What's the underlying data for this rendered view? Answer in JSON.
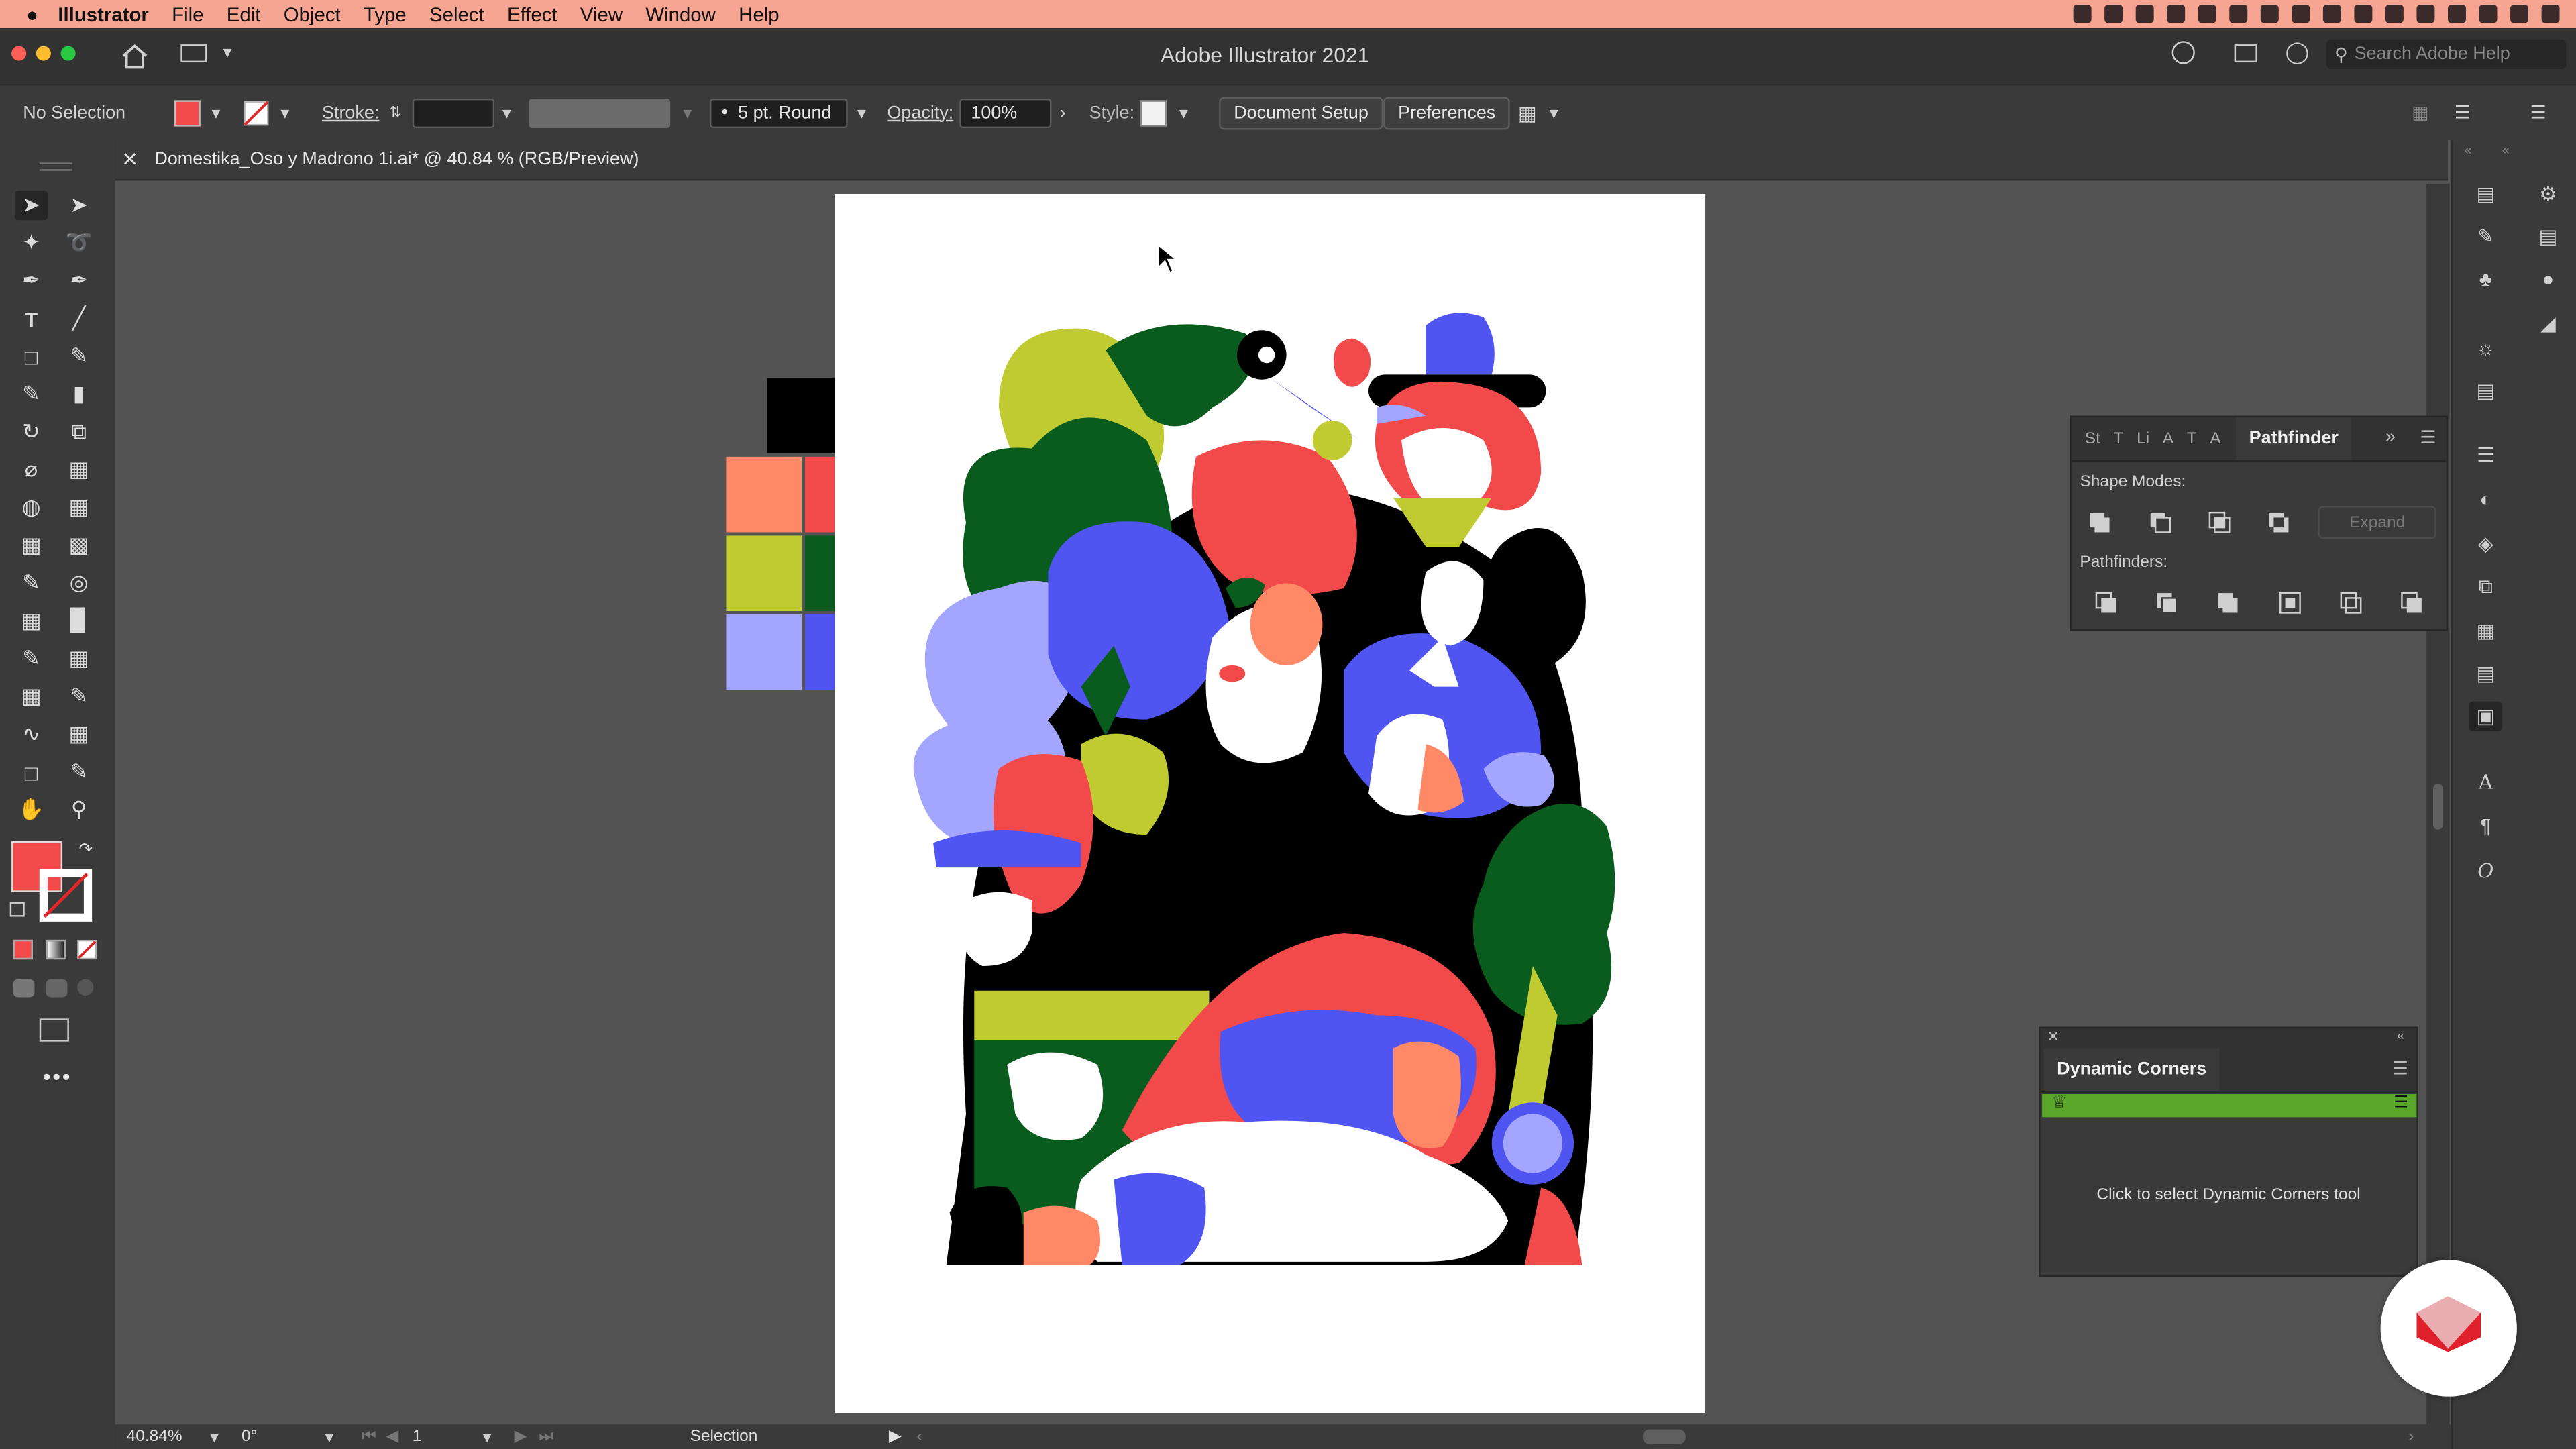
{
  "menubar": {
    "app_name": "Illustrator",
    "items": [
      "File",
      "Edit",
      "Object",
      "Type",
      "Select",
      "Effect",
      "View",
      "Window",
      "Help"
    ]
  },
  "appbar": {
    "title": "Adobe Illustrator 2021",
    "search_placeholder": "Search Adobe Help"
  },
  "control_bar": {
    "selection_label": "No Selection",
    "fill_color": "#f2494a",
    "stroke_label": "Stroke:",
    "brush_label": "5 pt. Round",
    "opacity_label": "Opacity:",
    "opacity_value": "100%",
    "style_label": "Style:",
    "document_setup_label": "Document Setup",
    "preferences_label": "Preferences"
  },
  "document_tab": {
    "title": "Domestika_Oso y Madrono 1i.ai* @ 40.84 % (RGB/Preview)"
  },
  "pathfinder_panel": {
    "tabs": [
      "St",
      "T",
      "Li",
      "A",
      "T",
      "A"
    ],
    "active_tab": "Pathfinder",
    "shape_modes_label": "Shape Modes:",
    "expand_label": "Expand",
    "pathfinders_label": "Pathfinders:"
  },
  "dynamic_corners_panel": {
    "title": "Dynamic Corners",
    "message": "Click to select Dynamic Corners tool",
    "bar_color": "#5aa62a"
  },
  "status_bar": {
    "zoom": "40.84%",
    "rotation": "0°",
    "artboard_number": "1",
    "tool_name": "Selection"
  },
  "swatches": {
    "colors": [
      "#000000",
      "#ff8866",
      "#f2494a",
      "#bfcb31",
      "#0a5c1e",
      "#a3a5ff",
      "#5055f2"
    ]
  },
  "icons": {
    "apple": "apple-icon",
    "home": "home-icon",
    "search": "search-icon",
    "domestika": "domestika-logo"
  }
}
